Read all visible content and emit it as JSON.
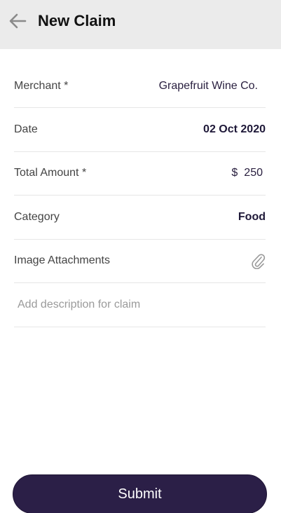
{
  "header": {
    "title": "New Claim",
    "back_icon": "arrow-left-icon"
  },
  "form": {
    "merchant": {
      "label": "Merchant *",
      "value": "Grapefruit Wine Co."
    },
    "date": {
      "label": "Date",
      "value": "02 Oct 2020"
    },
    "amount": {
      "label": "Total Amount *",
      "currency": "$",
      "value": "250"
    },
    "category": {
      "label": "Category",
      "value": "Food"
    },
    "attachments": {
      "label": "Image Attachments",
      "icon": "paperclip-icon"
    },
    "description": {
      "placeholder": "Add description for claim"
    }
  },
  "actions": {
    "submit_label": "Submit"
  },
  "colors": {
    "header_bg": "#ebebeb",
    "accent": "#2b1f47"
  }
}
